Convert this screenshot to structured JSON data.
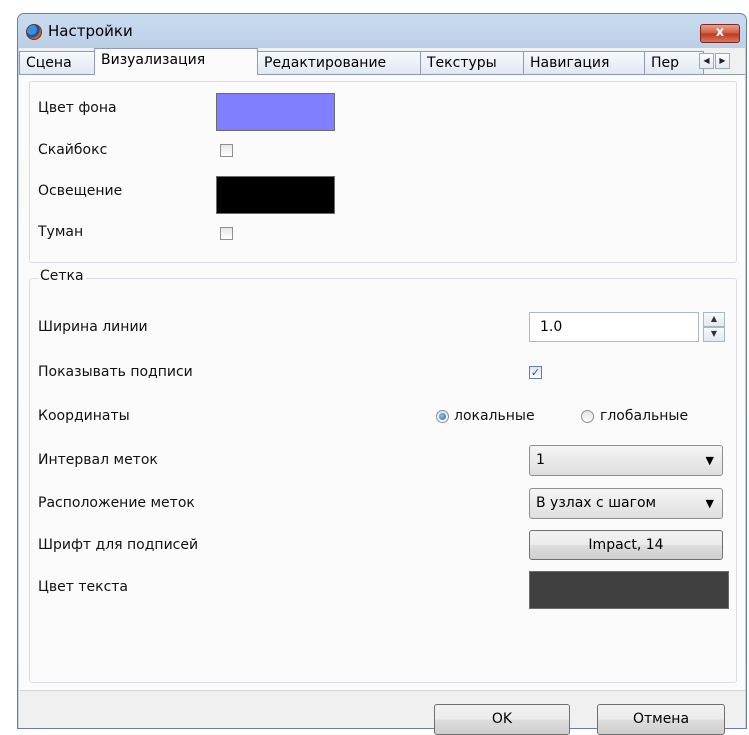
{
  "window": {
    "title": "Настройки",
    "close_label": "x"
  },
  "tabs": [
    {
      "label": "Сцена"
    },
    {
      "label": "Визуализация",
      "active": true
    },
    {
      "label": "Редактирование"
    },
    {
      "label": "Текстуры"
    },
    {
      "label": "Навигация"
    },
    {
      "label": "Пер"
    }
  ],
  "tab_scroll": {
    "left_icon": "scroll-left-icon",
    "right_icon": "scroll-right-icon"
  },
  "visualization": {
    "background_color": {
      "label": "Цвет фона",
      "color": "#8080ff"
    },
    "skybox": {
      "label": "Скайбокс",
      "checked": false
    },
    "lighting": {
      "label": "Освещение",
      "color": "#000000"
    },
    "fog": {
      "label": "Туман",
      "checked": false
    }
  },
  "grid": {
    "group_title": "Сетка",
    "line_width": {
      "label": "Ширина линии",
      "value": "1.0"
    },
    "show_labels": {
      "label": "Показывать подписи",
      "checked": true,
      "check_glyph": "✓"
    },
    "coordinates": {
      "label": "Координаты",
      "options": [
        {
          "label": "локальные",
          "selected": true
        },
        {
          "label": "глобальные",
          "selected": false
        }
      ]
    },
    "label_interval": {
      "label": "Интервал меток",
      "value": "1"
    },
    "label_placement": {
      "label": "Расположение меток",
      "value": "В узлах с шагом"
    },
    "label_font": {
      "label": "Шрифт для подписей",
      "value": "Impact, 14"
    },
    "text_color": {
      "label": "Цвет текста",
      "color": "#404040"
    }
  },
  "footer": {
    "ok_label": "OK",
    "cancel_label": "Отмена"
  }
}
